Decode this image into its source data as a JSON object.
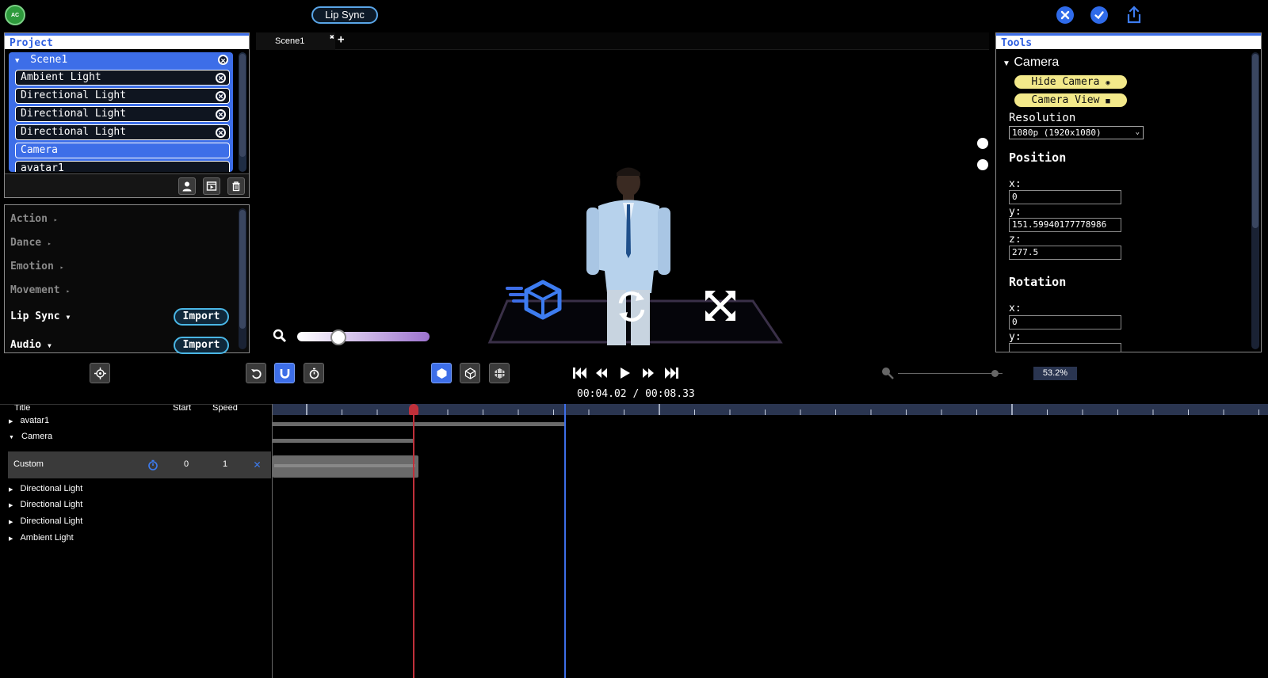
{
  "app": {
    "logo_text": "AC",
    "mode_label": "Lip Sync",
    "top_actions": [
      "close-icon",
      "check-icon",
      "share-icon"
    ]
  },
  "project": {
    "title": "Project",
    "scene": "Scene1",
    "items": [
      "Ambient Light",
      "Directional Light",
      "Directional Light",
      "Directional Light",
      "Camera",
      "avatar1"
    ]
  },
  "library": {
    "items": [
      "Action",
      "Dance",
      "Emotion",
      "Movement",
      "Lip Sync",
      "Audio"
    ],
    "import_label": "Import"
  },
  "viewport": {
    "tab": "Scene1"
  },
  "tools": {
    "title": "Tools",
    "section": "Camera",
    "hide_camera": "Hide Camera",
    "camera_view": "Camera View",
    "resolution_label": "Resolution",
    "resolution_value": "1080p (1920x1080)",
    "position_title": "Position",
    "rotation_title": "Rotation",
    "pos_x_label": "x:",
    "pos_y_label": "y:",
    "pos_z_label": "z:",
    "pos_x": "0",
    "pos_y": "151.59940177778986",
    "pos_z": "277.5",
    "rot_x_label": "x:",
    "rot_y_label": "y:",
    "rot_x": "0"
  },
  "playback": {
    "time_current": "00:04.02",
    "time_total": "00:08.33",
    "zoom_percent": "53.2%"
  },
  "timeline": {
    "col_title": "Title",
    "col_start": "Start",
    "col_speed": "Speed",
    "rows": [
      "avatar1",
      "Camera",
      "Directional Light",
      "Directional Light",
      "Directional Light",
      "Ambient Light"
    ],
    "custom": {
      "name": "Custom",
      "start": "0",
      "speed": "1"
    }
  },
  "colors": {
    "accent": "#3d6ee8",
    "playhead": "#c0303a",
    "highlight": "#f3e98a"
  }
}
